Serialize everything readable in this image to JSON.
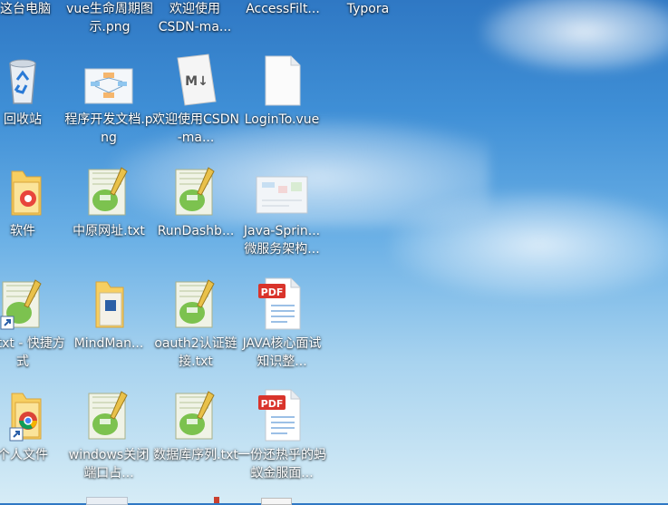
{
  "top_row": [
    {
      "label": "这台电脑"
    },
    {
      "label": "vue生命周期图示.png"
    },
    {
      "label": "欢迎使用CSDN-ma..."
    },
    {
      "label": "AccessFilt..."
    },
    {
      "label": "Typora"
    }
  ],
  "rows": [
    [
      {
        "label": "回收站",
        "icon": "recycle-bin-icon"
      },
      {
        "label": "程序开发文档.png",
        "icon": "image-file-icon"
      },
      {
        "label": "欢迎使用CSDN-ma...",
        "icon": "markdown-file-icon"
      },
      {
        "label": "LoginTo.vue",
        "icon": "blank-file-icon"
      }
    ],
    [
      {
        "label": "软件",
        "icon": "folder-icon"
      },
      {
        "label": "中原网址.txt",
        "icon": "notepad-plus-file-icon"
      },
      {
        "label": "RunDashb...",
        "icon": "notepad-plus-file-icon"
      },
      {
        "label": "Java-Sprin...微服务架构...",
        "icon": "image-file-icon"
      }
    ],
    [
      {
        "label": "号.txt - 快捷方式",
        "icon": "notepad-plus-shortcut-icon"
      },
      {
        "label": "MindMan...",
        "icon": "folder-icon"
      },
      {
        "label": "oauth2认证链接.txt",
        "icon": "notepad-plus-file-icon"
      },
      {
        "label": "JAVA核心面试知识整...",
        "icon": "pdf-file-icon"
      }
    ],
    [
      {
        "label": "个人文件",
        "icon": "chrome-folder-icon"
      },
      {
        "label": "windows关闭端口占...",
        "icon": "notepad-plus-file-icon"
      },
      {
        "label": "数据库序列.txt",
        "icon": "notepad-plus-file-icon"
      },
      {
        "label": "一份还热乎的蚂蚁金服面...",
        "icon": "pdf-file-icon"
      }
    ]
  ],
  "pdf_badge": "PDF",
  "md_badge": "M↓"
}
